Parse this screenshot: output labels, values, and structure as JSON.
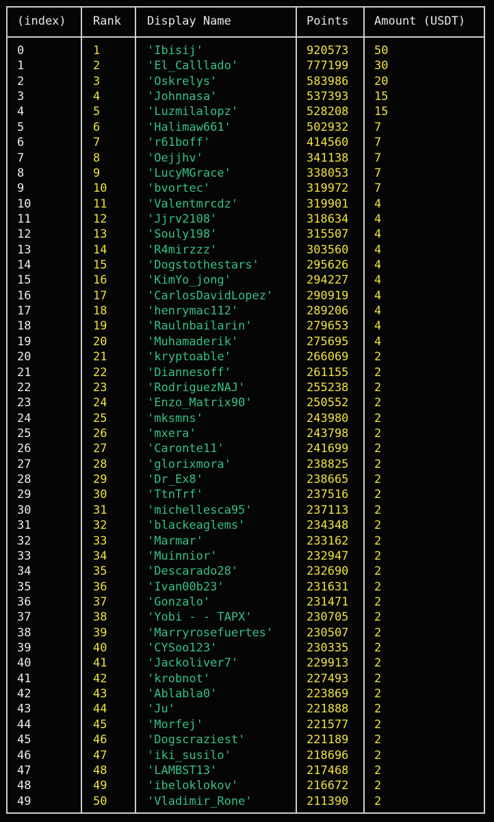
{
  "columns": [
    "(index)",
    "Rank",
    "Display Name",
    "Points",
    "Amount (USDT)"
  ],
  "colors": {
    "background": "#050505",
    "border": "#cfcfcf",
    "index_text": "#ececec",
    "string_value": "#33c286",
    "number_value": "#f0e33a"
  },
  "rows": [
    {
      "index": "0",
      "rank": "1",
      "name": "'Ibisij'",
      "points": "920573",
      "amount": "50"
    },
    {
      "index": "1",
      "rank": "2",
      "name": "'El_Calllado'",
      "points": "777199",
      "amount": "30"
    },
    {
      "index": "2",
      "rank": "3",
      "name": "'Oskrelys'",
      "points": "583986",
      "amount": "20"
    },
    {
      "index": "3",
      "rank": "4",
      "name": "'Johnnasa'",
      "points": "537393",
      "amount": "15"
    },
    {
      "index": "4",
      "rank": "5",
      "name": "'Luzmilalopz'",
      "points": "528208",
      "amount": "15"
    },
    {
      "index": "5",
      "rank": "6",
      "name": "'Halimaw661'",
      "points": "502932",
      "amount": "7"
    },
    {
      "index": "6",
      "rank": "7",
      "name": "'r61boff'",
      "points": "414560",
      "amount": "7"
    },
    {
      "index": "7",
      "rank": "8",
      "name": "'Oejjhv'",
      "points": "341138",
      "amount": "7"
    },
    {
      "index": "8",
      "rank": "9",
      "name": "'LucyMGrace'",
      "points": "338053",
      "amount": "7"
    },
    {
      "index": "9",
      "rank": "10",
      "name": "'bvortec'",
      "points": "319972",
      "amount": "7"
    },
    {
      "index": "10",
      "rank": "11",
      "name": "'Valentmrcdz'",
      "points": "319901",
      "amount": "4"
    },
    {
      "index": "11",
      "rank": "12",
      "name": "'Jjrv2108'",
      "points": "318634",
      "amount": "4"
    },
    {
      "index": "12",
      "rank": "13",
      "name": "'Souly198'",
      "points": "315507",
      "amount": "4"
    },
    {
      "index": "13",
      "rank": "14",
      "name": "'R4mirzzz'",
      "points": "303560",
      "amount": "4"
    },
    {
      "index": "14",
      "rank": "15",
      "name": "'Dogstothestars'",
      "points": "295626",
      "amount": "4"
    },
    {
      "index": "15",
      "rank": "16",
      "name": "'KimYo_jong'",
      "points": "294227",
      "amount": "4"
    },
    {
      "index": "16",
      "rank": "17",
      "name": "'CarlosDavidLopez'",
      "points": "290919",
      "amount": "4"
    },
    {
      "index": "17",
      "rank": "18",
      "name": "'henrymac112'",
      "points": "289206",
      "amount": "4"
    },
    {
      "index": "18",
      "rank": "19",
      "name": "'Raulnbailarin'",
      "points": "279653",
      "amount": "4"
    },
    {
      "index": "19",
      "rank": "20",
      "name": "'Muhamaderik'",
      "points": "275695",
      "amount": "4"
    },
    {
      "index": "20",
      "rank": "21",
      "name": "'kryptoable'",
      "points": "266069",
      "amount": "2"
    },
    {
      "index": "21",
      "rank": "22",
      "name": "'Diannesoff'",
      "points": "261155",
      "amount": "2"
    },
    {
      "index": "22",
      "rank": "23",
      "name": "'RodriguezNAJ'",
      "points": "255238",
      "amount": "2"
    },
    {
      "index": "23",
      "rank": "24",
      "name": "'Enzo_Matrix90'",
      "points": "250552",
      "amount": "2"
    },
    {
      "index": "24",
      "rank": "25",
      "name": "'mksmns'",
      "points": "243980",
      "amount": "2"
    },
    {
      "index": "25",
      "rank": "26",
      "name": "'mxera'",
      "points": "243798",
      "amount": "2"
    },
    {
      "index": "26",
      "rank": "27",
      "name": "'Caronte11'",
      "points": "241699",
      "amount": "2"
    },
    {
      "index": "27",
      "rank": "28",
      "name": "'glorixmora'",
      "points": "238825",
      "amount": "2"
    },
    {
      "index": "28",
      "rank": "29",
      "name": "'Dr_Ex8'",
      "points": "238665",
      "amount": "2"
    },
    {
      "index": "29",
      "rank": "30",
      "name": "'TtnTrf'",
      "points": "237516",
      "amount": "2"
    },
    {
      "index": "30",
      "rank": "31",
      "name": "'michellesca95'",
      "points": "237113",
      "amount": "2"
    },
    {
      "index": "31",
      "rank": "32",
      "name": "'blackeaglems'",
      "points": "234348",
      "amount": "2"
    },
    {
      "index": "32",
      "rank": "33",
      "name": "'Marmar'",
      "points": "233162",
      "amount": "2"
    },
    {
      "index": "33",
      "rank": "34",
      "name": "'Muinnior'",
      "points": "232947",
      "amount": "2"
    },
    {
      "index": "34",
      "rank": "35",
      "name": "'Descarado28'",
      "points": "232690",
      "amount": "2"
    },
    {
      "index": "35",
      "rank": "36",
      "name": "'Ivan00b23'",
      "points": "231631",
      "amount": "2"
    },
    {
      "index": "36",
      "rank": "37",
      "name": "'Gonzalo'",
      "points": "231471",
      "amount": "2"
    },
    {
      "index": "37",
      "rank": "38",
      "name": "'Yobi -  - TAPX'",
      "points": "230705",
      "amount": "2"
    },
    {
      "index": "38",
      "rank": "39",
      "name": "'Marryrosefuertes'",
      "points": "230507",
      "amount": "2"
    },
    {
      "index": "39",
      "rank": "40",
      "name": "'CYSoo123'",
      "points": "230335",
      "amount": "2"
    },
    {
      "index": "40",
      "rank": "41",
      "name": "'Jackoliver7'",
      "points": "229913",
      "amount": "2"
    },
    {
      "index": "41",
      "rank": "42",
      "name": "'krobnot'",
      "points": "227493",
      "amount": "2"
    },
    {
      "index": "42",
      "rank": "43",
      "name": "'Ablabla0'",
      "points": "223869",
      "amount": "2"
    },
    {
      "index": "43",
      "rank": "44",
      "name": "'Ju'",
      "points": "221888",
      "amount": "2"
    },
    {
      "index": "44",
      "rank": "45",
      "name": "'Morfej'",
      "points": "221577",
      "amount": "2"
    },
    {
      "index": "45",
      "rank": "46",
      "name": "'Dogscraziest'",
      "points": "221189",
      "amount": "2"
    },
    {
      "index": "46",
      "rank": "47",
      "name": "'iki_susilo'",
      "points": "218696",
      "amount": "2"
    },
    {
      "index": "47",
      "rank": "48",
      "name": "'LAMBST13'",
      "points": "217468",
      "amount": "2"
    },
    {
      "index": "48",
      "rank": "49",
      "name": "'ibeloklokov'",
      "points": "216672",
      "amount": "2"
    },
    {
      "index": "49",
      "rank": "50",
      "name": "'Vladimir_Rone'",
      "points": "211390",
      "amount": "2"
    }
  ]
}
